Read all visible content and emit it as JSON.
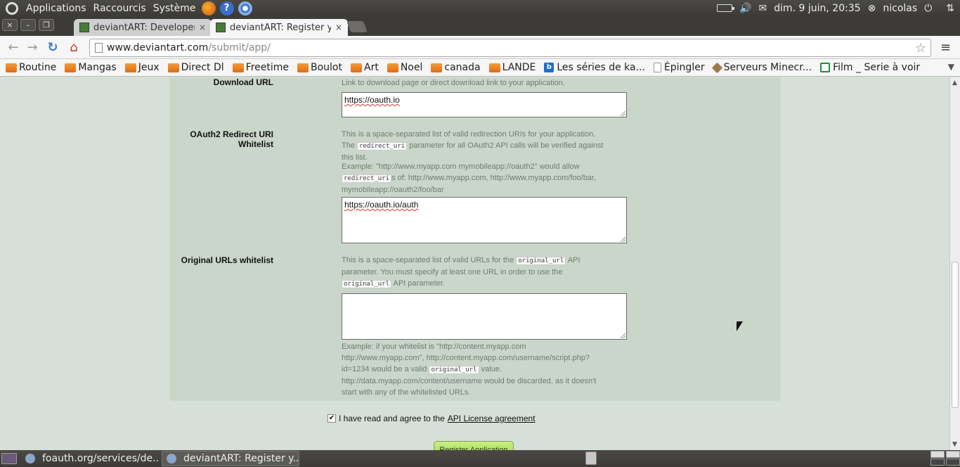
{
  "top_panel": {
    "menus": [
      "Applications",
      "Raccourcis",
      "Système"
    ],
    "datetime": "dim.  9 juin, 20:35",
    "user": "nicolas"
  },
  "tabs": [
    {
      "title": "deviantART: Developers",
      "close": "×"
    },
    {
      "title": "deviantART: Register yo",
      "close": "×"
    }
  ],
  "window_buttons": {
    "close": "×",
    "minimize": "–",
    "restore": "❐"
  },
  "toolbar": {
    "back": "←",
    "forward": "→",
    "reload": "↻",
    "home": "⌂",
    "url_host": "www.deviantart.com",
    "url_path": "/submit/app/",
    "star": "☆",
    "menu": "≡"
  },
  "bookmarks": [
    {
      "label": "Routine",
      "icon": "folder-icon"
    },
    {
      "label": "Mangas",
      "icon": "folder-icon"
    },
    {
      "label": "Jeux",
      "icon": "folder-icon"
    },
    {
      "label": "Direct Dl",
      "icon": "folder-icon"
    },
    {
      "label": "Freetime",
      "icon": "folder-icon"
    },
    {
      "label": "Boulot",
      "icon": "folder-icon"
    },
    {
      "label": "Art",
      "icon": "folder-icon"
    },
    {
      "label": "Noel",
      "icon": "folder-icon"
    },
    {
      "label": "canada",
      "icon": "folder-icon"
    },
    {
      "label": "LANDE",
      "icon": "folder-icon"
    },
    {
      "label": "Les séries de ka...",
      "icon": "b-icon"
    },
    {
      "label": "Épingler",
      "icon": "page-icon"
    },
    {
      "label": "Serveurs Minecr...",
      "icon": "tag-icon"
    },
    {
      "label": "Film _ Serie à voir",
      "icon": "sheet-icon"
    }
  ],
  "form": {
    "download_url": {
      "label": "Download URL",
      "help": "Link to download page or direct download link to your application.",
      "value": "https://oauth.io"
    },
    "redirect": {
      "label_line1": "OAuth2 Redirect URI",
      "label_line2": "Whitelist",
      "help_a": "This is a space-separated list of valid redirection URIs for your application. The",
      "code": "redirect_uri",
      "help_b": "parameter for all OAuth2 API calls will be verified against this list.",
      "example_a": "Example: \"http://www.myapp.com mymobileapp://oauth2\" would allow",
      "example_b": "s of: http://www.myapp.com, http://www.myapp.com/foo/bar, mymobileapp://oauth2/foo/bar",
      "value": "https://oauth.io/auth"
    },
    "original": {
      "label": "Original URLs whitelist",
      "help_a": "This is a space-separated list of valid URLs for the",
      "code": "original_url",
      "help_b": "API parameter. You must specify at least one URL in order to use the",
      "help_c": "API parameter.",
      "value": "",
      "example_a": "Example: if your whitelist is \"http://content.myapp.com http://www.myapp.com\", http://content.myapp.com/username/script.php?id=1234 would be a valid",
      "example_b": "value. http://data.myapp.com/content/username would be discarded, as it doesn't start with any of the whitelisted URLs."
    },
    "agree_text": "I have read and agree to the",
    "agree_link": "API License agreement",
    "register_label": "Register Application"
  },
  "taskbar": [
    {
      "title": "foauth.org/services/de..."
    },
    {
      "title": "deviantART: Register y..."
    }
  ],
  "colors": {
    "panel_bg": "#cbd6cb",
    "page_bg": "#d7e0d8",
    "button_green": "#9fd34e"
  }
}
